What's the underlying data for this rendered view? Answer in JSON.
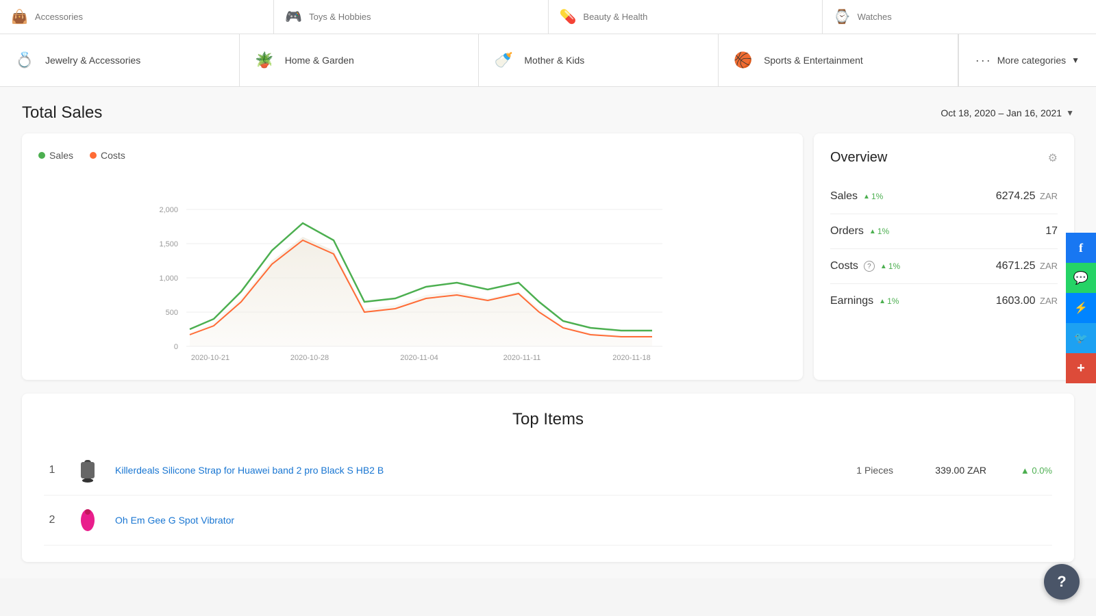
{
  "top_categories": [
    {
      "id": "accessories",
      "label": "Accessories",
      "icon": "👜"
    },
    {
      "id": "toys-hobbies",
      "label": "Toys & Hobbies",
      "icon": "🎮"
    },
    {
      "id": "beauty-health",
      "label": "Beauty & Health",
      "icon": "💊"
    },
    {
      "id": "watches",
      "label": "Watches",
      "icon": "⌚"
    }
  ],
  "main_categories": [
    {
      "id": "jewelry",
      "label": "Jewelry & Accessories",
      "icon": "💍"
    },
    {
      "id": "home-garden",
      "label": "Home & Garden",
      "icon": "🪴"
    },
    {
      "id": "mother-kids",
      "label": "Mother & Kids",
      "icon": "🍼"
    },
    {
      "id": "sports",
      "label": "Sports & Entertainment",
      "icon": "🏀"
    }
  ],
  "more_categories": {
    "label": "More categories",
    "icon": "···"
  },
  "total_sales": {
    "title": "Total Sales",
    "date_range": "Oct 18, 2020 – Jan 16, 2021",
    "legend": {
      "sales_label": "Sales",
      "costs_label": "Costs"
    }
  },
  "chart": {
    "y_labels": [
      "0",
      "500",
      "1,000",
      "1,500",
      "2,000"
    ],
    "x_labels": [
      "2020-10-21",
      "2020-10-28",
      "2020-11-04",
      "2020-11-11",
      "2020-11-18"
    ]
  },
  "overview": {
    "title": "Overview",
    "rows": [
      {
        "id": "sales",
        "label": "Sales",
        "trend": "1%",
        "value": "6274.25",
        "currency": "ZAR",
        "has_question": false
      },
      {
        "id": "orders",
        "label": "Orders",
        "trend": "1%",
        "value": "17",
        "currency": "",
        "has_question": false
      },
      {
        "id": "costs",
        "label": "Costs",
        "trend": "1%",
        "value": "4671.25",
        "currency": "ZAR",
        "has_question": true
      },
      {
        "id": "earnings",
        "label": "Earnings",
        "trend": "1%",
        "value": "1603.00",
        "currency": "ZAR",
        "has_question": false
      }
    ]
  },
  "top_items": {
    "title": "Top Items",
    "items": [
      {
        "rank": "1",
        "name": "Killerdeals Silicone Strap for Huawei band 2 pro Black S HB2 B",
        "pieces": "1 Pieces",
        "price": "339.00 ZAR",
        "trend": "▲ 0.0%",
        "img_color": "#444"
      },
      {
        "rank": "2",
        "name": "Oh Em Gee G Spot Vibrator",
        "pieces": "",
        "price": "",
        "trend": "",
        "img_color": "#e91e8c"
      }
    ]
  },
  "social": [
    {
      "id": "facebook",
      "icon": "f",
      "bg": "#1877f2"
    },
    {
      "id": "whatsapp",
      "icon": "💬",
      "bg": "#25d366"
    },
    {
      "id": "messenger",
      "icon": "⚡",
      "bg": "#0084ff"
    },
    {
      "id": "twitter",
      "icon": "🐦",
      "bg": "#1da1f2"
    },
    {
      "id": "plus",
      "icon": "+",
      "bg": "#dd4b39"
    }
  ],
  "help_btn": "?"
}
